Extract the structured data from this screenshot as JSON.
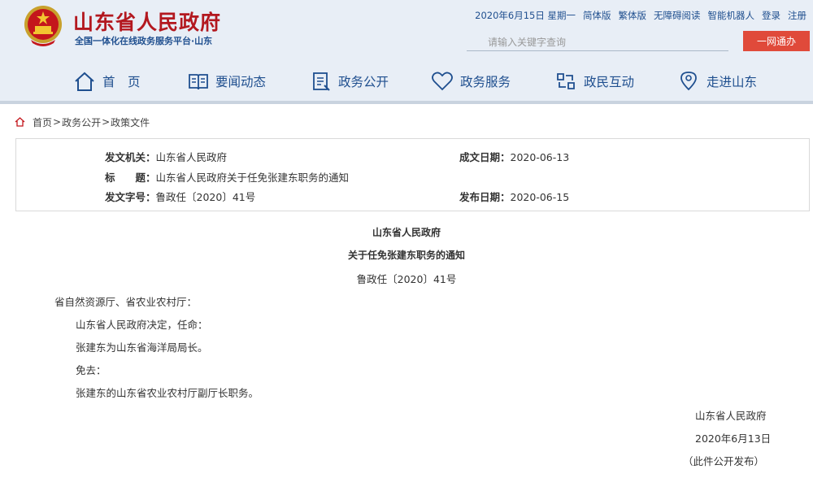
{
  "header": {
    "site_name": "山东省人民政府",
    "slogan": "全国一体化在线政务服务平台·山东",
    "top_links": {
      "date": "2020年6月15日 星期一",
      "simplified": "简体版",
      "traditional": "繁体版",
      "accessibility": "无障碍阅读",
      "robot": "智能机器人",
      "login": "登录",
      "register": "注册"
    },
    "search_placeholder": "请输入关键字查询",
    "one_stop_button": "一网通办",
    "accent_red": "#b3181f",
    "nav_blue": "#1f4f8f"
  },
  "nav": {
    "home": "首　页",
    "news": "要闻动态",
    "public_affairs": "政务公开",
    "services": "政务服务",
    "interaction": "政民互动",
    "about": "走进山东"
  },
  "breadcrumb": {
    "home": "首页",
    "level1": "政务公开",
    "level2": "政策文件",
    "separator": ">"
  },
  "meta": {
    "issuer_label": "发文机关：",
    "issuer": "山东省人民政府",
    "date_made_label": "成文日期：",
    "date_made": "2020-06-13",
    "title_label": "标　　题：",
    "title": "山东省人民政府关于任免张建东职务的通知",
    "doc_no_label": "发文字号：",
    "doc_no": "鲁政任〔2020〕41号",
    "publish_date_label": "发布日期：",
    "publish_date": "2020-06-15"
  },
  "document": {
    "org": "山东省人民政府",
    "title": "关于任免张建东职务的通知",
    "number": "鲁政任〔2020〕41号",
    "addressee": "省自然资源厅、省农业农村厅：",
    "paragraphs": [
      "山东省人民政府决定，任命：",
      "张建东为山东省海洋局局长。",
      "免去：",
      "张建东的山东省农业农村厅副厅长职务。"
    ],
    "signature": "山东省人民政府",
    "sign_date": "2020年6月13日",
    "note": "（此件公开发布）"
  }
}
